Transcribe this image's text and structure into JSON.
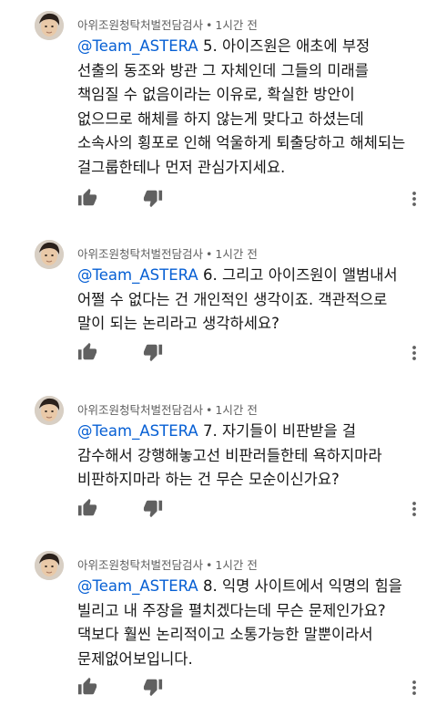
{
  "comments": [
    {
      "author": "아위조원청탁처벌전담검사",
      "separator": "•",
      "time": "1시간 전",
      "mention": "@Team_ASTERA",
      "lines": [
        " 5. 아이즈원은 애초에 부정",
        "선출의 동조와 방관 그 자체인데 그들의 미래를",
        "책임질 수 없음이라는 이유로, 확실한 방안이",
        "없으므로 해체를 하지 않는게 맞다고 하셨는데",
        "소속사의 횡포로 인해 억울하게 퇴출당하고 해체되는",
        "걸그룹한테나 먼저 관심가지세요."
      ],
      "icons": {
        "like": "thumbs-up-icon",
        "dislike": "thumbs-down-icon",
        "more": "more-vertical-icon"
      }
    },
    {
      "author": "아위조원청탁처벌전담검사",
      "separator": "•",
      "time": "1시간 전",
      "mention": "@Team_ASTERA",
      "lines": [
        " 6. 그리고 아이즈원이 앨범내서",
        "어쩔 수 없다는 건 개인적인 생각이죠. 객관적으로",
        "말이 되는 논리라고 생각하세요?"
      ],
      "icons": {
        "like": "thumbs-up-icon",
        "dislike": "thumbs-down-icon",
        "more": "more-vertical-icon"
      }
    },
    {
      "author": "아위조원청탁처벌전담검사",
      "separator": "•",
      "time": "1시간 전",
      "mention": "@Team_ASTERA",
      "lines": [
        " 7. 자기들이 비판받을 걸",
        "감수해서 강행해놓고선 비판러들한테 욕하지마라",
        "비판하지마라 하는 건 무슨 모순이신가요?"
      ],
      "icons": {
        "like": "thumbs-up-icon",
        "dislike": "thumbs-down-icon",
        "more": "more-vertical-icon"
      }
    },
    {
      "author": "아위조원청탁처벌전담검사",
      "separator": "•",
      "time": "1시간 전",
      "mention": "@Team_ASTERA",
      "lines": [
        " 8. 익명 사이트에서 익명의 힘을",
        "빌리고 내 주장을 펼치겠다는데 무슨 문제인가요?",
        "댁보다 훨씬 논리적이고 소통가능한 말뿐이라서",
        "문제없어보입니다."
      ],
      "icons": {
        "like": "thumbs-up-icon",
        "dislike": "thumbs-down-icon",
        "more": "more-vertical-icon"
      }
    }
  ],
  "colors": {
    "mention": "#065fd4",
    "meta": "#606060",
    "text": "#161616",
    "icon": "#606060"
  }
}
